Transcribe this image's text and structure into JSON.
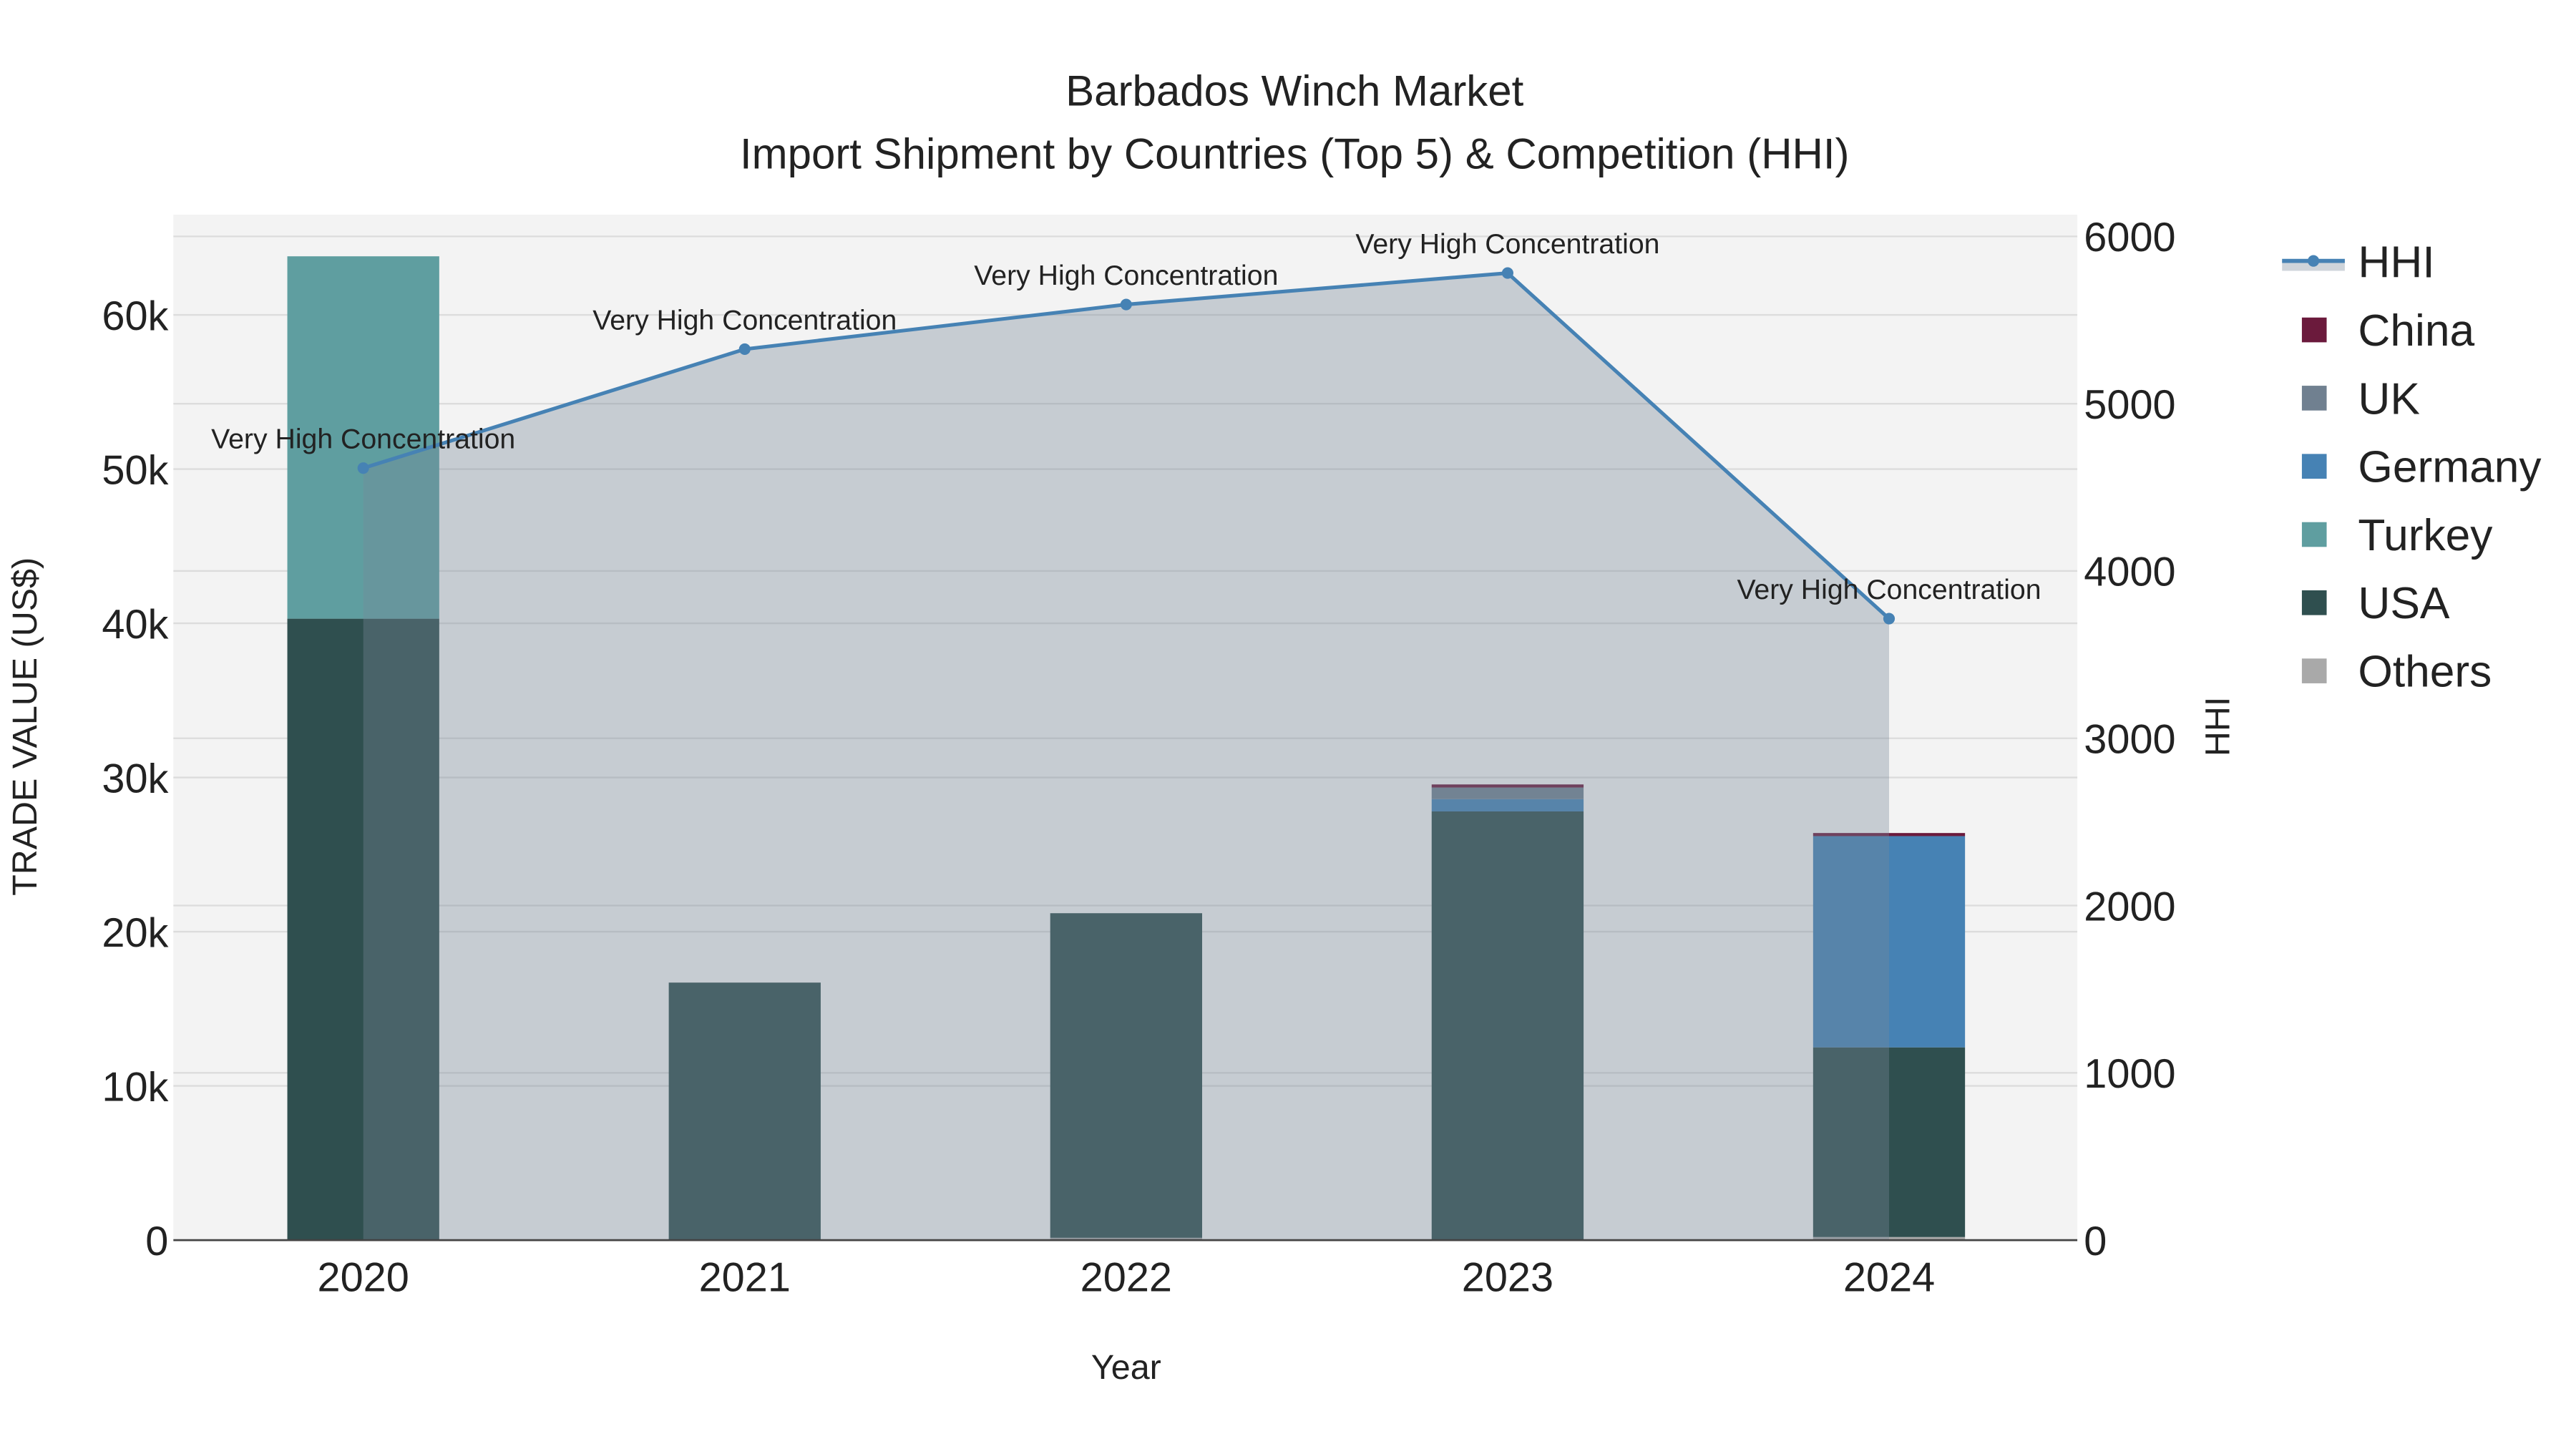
{
  "chart_data": {
    "type": "bar",
    "title_line1": "Barbados Winch Market",
    "title_line2": "Import Shipment by Countries (Top 5) & Competition (HHI)",
    "xlabel": "Year",
    "ylabel": "TRADE VALUE (US$)",
    "y2label": "HHI",
    "categories": [
      "2020",
      "2021",
      "2022",
      "2023",
      "2024"
    ],
    "ylim": [
      0,
      66500
    ],
    "y2lim": [
      0,
      6130
    ],
    "yticks": [
      0,
      10000,
      20000,
      30000,
      40000,
      50000,
      60000
    ],
    "ytick_labels": [
      "0",
      "10k",
      "20k",
      "30k",
      "40k",
      "50k",
      "60k"
    ],
    "y2ticks": [
      0,
      1000,
      2000,
      3000,
      4000,
      5000,
      6000
    ],
    "y2tick_labels": [
      "0",
      "1000",
      "2000",
      "3000",
      "4000",
      "5000",
      "6000"
    ],
    "grid": true,
    "legend_position": "right",
    "series": [
      {
        "name": "Others",
        "color": "#a9a9a9",
        "values": [
          0,
          0,
          150,
          0,
          200
        ]
      },
      {
        "name": "USA",
        "color": "#2f4f4f",
        "values": [
          40300,
          16700,
          21050,
          27800,
          12300
        ]
      },
      {
        "name": "Turkey",
        "color": "#5f9ea0",
        "values": [
          23500,
          0,
          0,
          0,
          0
        ]
      },
      {
        "name": "Germany",
        "color": "#4682b4",
        "values": [
          0,
          0,
          0,
          800,
          13700
        ]
      },
      {
        "name": "UK",
        "color": "#708090",
        "values": [
          0,
          0,
          0,
          750,
          0
        ]
      },
      {
        "name": "China",
        "color": "#6b1a3c",
        "values": [
          0,
          0,
          0,
          200,
          200
        ]
      }
    ],
    "hhi": {
      "name": "HHI",
      "color": "#4682b4",
      "values": [
        4615,
        5326,
        5593,
        5781,
        3715
      ],
      "annotations": [
        "Very High Concentration",
        "Very High Concentration",
        "Very High Concentration",
        "Very High Concentration",
        "Very High Concentration"
      ]
    },
    "legend_order": [
      "HHI",
      "China",
      "UK",
      "Germany",
      "Turkey",
      "USA",
      "Others"
    ]
  }
}
